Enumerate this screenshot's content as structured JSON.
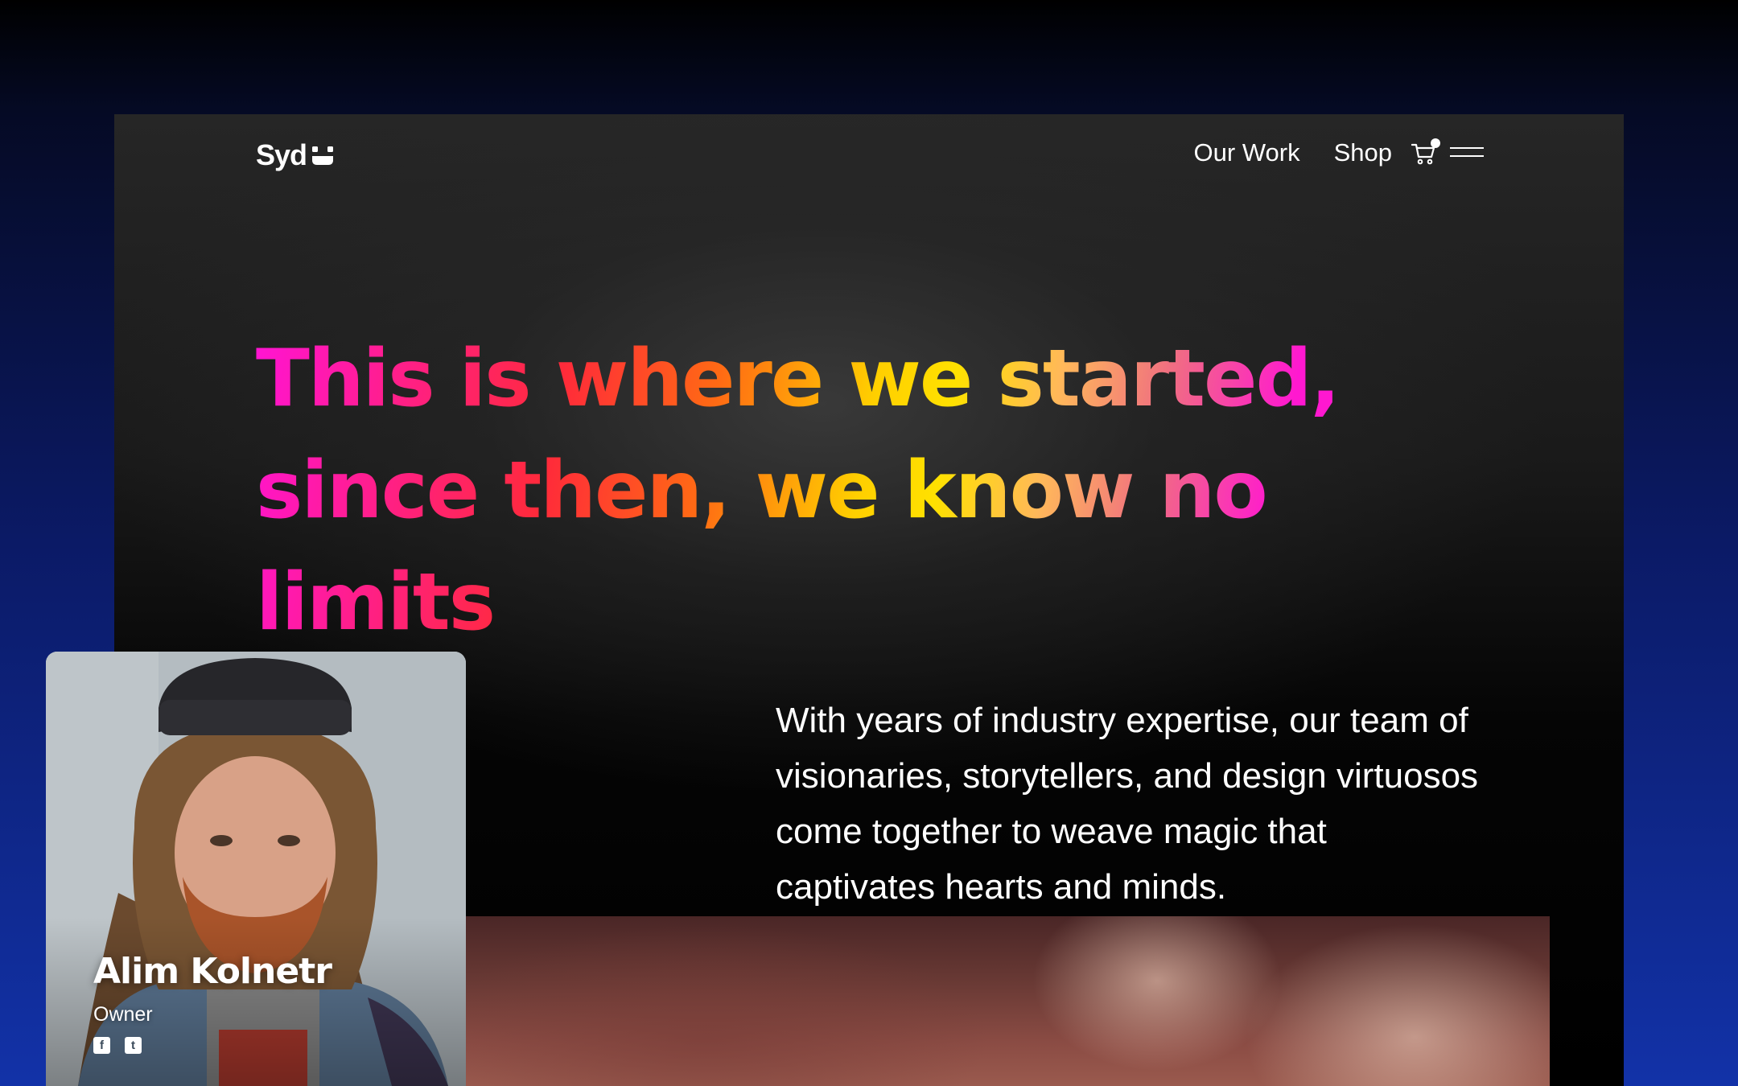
{
  "brand": {
    "logo_text": "Syd"
  },
  "nav": {
    "items": [
      {
        "label": "Our Work"
      },
      {
        "label": "Shop"
      }
    ],
    "cart_icon": "cart-icon",
    "menu_icon": "hamburger-menu-icon"
  },
  "hero": {
    "headline_lines": [
      "This is where we started,",
      "since then, we know no",
      "limits"
    ],
    "paragraph_lines": [
      "With years of industry expertise, our team of",
      "visionaries, storytellers, and design virtuosos",
      "come together to weave magic that",
      "captivates hearts and minds."
    ],
    "gradient_colors": [
      "#ff14d4",
      "#ff2a3a",
      "#ff6a14",
      "#ffe100",
      "#f07080",
      "#ff18d0"
    ]
  },
  "profile": {
    "name": "Alim Kolnetr",
    "role": "Owner",
    "social_icons": [
      "facebook-icon",
      "twitter-icon"
    ]
  },
  "colors": {
    "background_top": "#000000",
    "background_bottom": "#1232a8",
    "panel": "#262626",
    "text": "#ffffff"
  }
}
